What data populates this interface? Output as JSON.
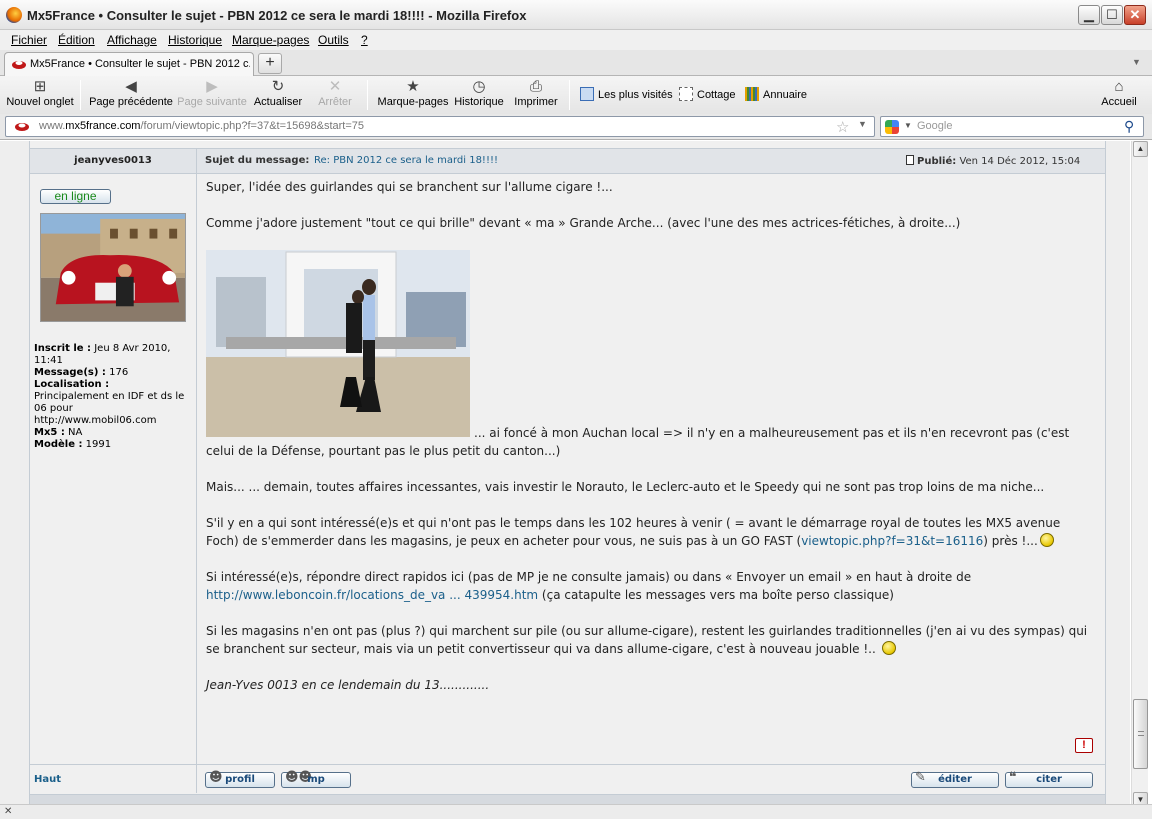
{
  "window": {
    "title": "Mx5France • Consulter le sujet - PBN 2012 ce sera le mardi 18!!!! - Mozilla Firefox",
    "minimize": "▁",
    "maximize": "☐",
    "close": "✕"
  },
  "menu": [
    "Fichier",
    "Édition",
    "Affichage",
    "Historique",
    "Marque-pages",
    "Outils",
    "?"
  ],
  "tab": {
    "title": "Mx5France • Consulter le sujet - PBN 2012 c...",
    "new_tab": "+"
  },
  "toolbar": {
    "new_tab": "Nouvel onglet",
    "back": "Page précédente",
    "forward": "Page suivante",
    "reload": "Actualiser",
    "stop": "Arrêter",
    "bookmarks": "Marque-pages",
    "history": "Historique",
    "print": "Imprimer",
    "home": "Accueil"
  },
  "bookmarks_bar": [
    "Les plus visités",
    "Cottage",
    "Annuaire"
  ],
  "url": {
    "prefix": "www.",
    "domain": "mx5france.com",
    "path": "/forum/viewtopic.php?f=37&t=15698&start=75"
  },
  "search": {
    "placeholder": "Google"
  },
  "post": {
    "author": "jeanyves0013",
    "subject_label": "Sujet du message:",
    "subject": "Re: PBN 2012 ce sera le mardi 18!!!!",
    "published_label": "Publié:",
    "published": "Ven 14 Déc 2012, 15:04",
    "online_badge": "en ligne",
    "profile": [
      {
        "label": "Inscrit le :",
        "value": "Jeu 8 Avr 2010, 11:41"
      },
      {
        "label": "Message(s) :",
        "value": "176"
      },
      {
        "label": "Localisation :",
        "value": "Principalement en IDF et ds le 06 pour http://www.mobil06.com"
      },
      {
        "label": "Mx5 :",
        "value": "NA"
      },
      {
        "label": "Modèle :",
        "value": "1991"
      }
    ],
    "paragraphs": [
      "Super, l'idée des guirlandes qui se branchent sur l'allume cigare !...",
      "Comme j'adore justement \"tout ce qui brille\" devant « ma » Grande Arche... (avec l'une des mes actrices-fétiches, à droite...)",
      "... ai foncé à mon Auchan local => il n'y en a malheureusement pas et ils n'en recevront pas (c'est celui de la Défense, pourtant pas le plus petit du canton...)",
      "Mais... ... demain, toutes affaires incessantes, vais investir le Norauto, le Leclerc-auto et le Speedy qui ne sont pas trop loins de ma niche...",
      "S'il y en a qui sont intéressé(e)s et qui n'ont pas le temps dans les 102 heures à venir ( = avant le démarrage royal de toutes les MX5 avenue Foch) de s'emmerder dans les magasins, je peux en acheter pour vous, ne suis pas à un GO FAST (",
      "viewtopic.php?f=31&t=16116",
      ") près !...",
      "Si intéressé(e)s, répondre direct rapidos ici (pas de MP je ne consulte jamais) ou dans « Envoyer un email » en haut à droite de",
      "http://www.leboncoin.fr/locations_de_va ... 439954.htm",
      " (ça catapulte les messages vers ma boîte perso classique)",
      "Si les magasins n'en ont pas (plus ?) qui marchent sur pile (ou sur allume-cigare), restent les guirlandes traditionnelles (j'en ai vu des sympas) qui se branchent sur secteur, mais via un petit convertisseur qui va dans allume-cigare, c'est à nouveau jouable !.. ",
      "Jean-Yves 0013 en ce lendemain du 13............."
    ],
    "report": "!",
    "haut": "Haut",
    "buttons": {
      "profil": "profil",
      "mp": "mp",
      "editer": "éditer",
      "citer": "citer"
    }
  }
}
